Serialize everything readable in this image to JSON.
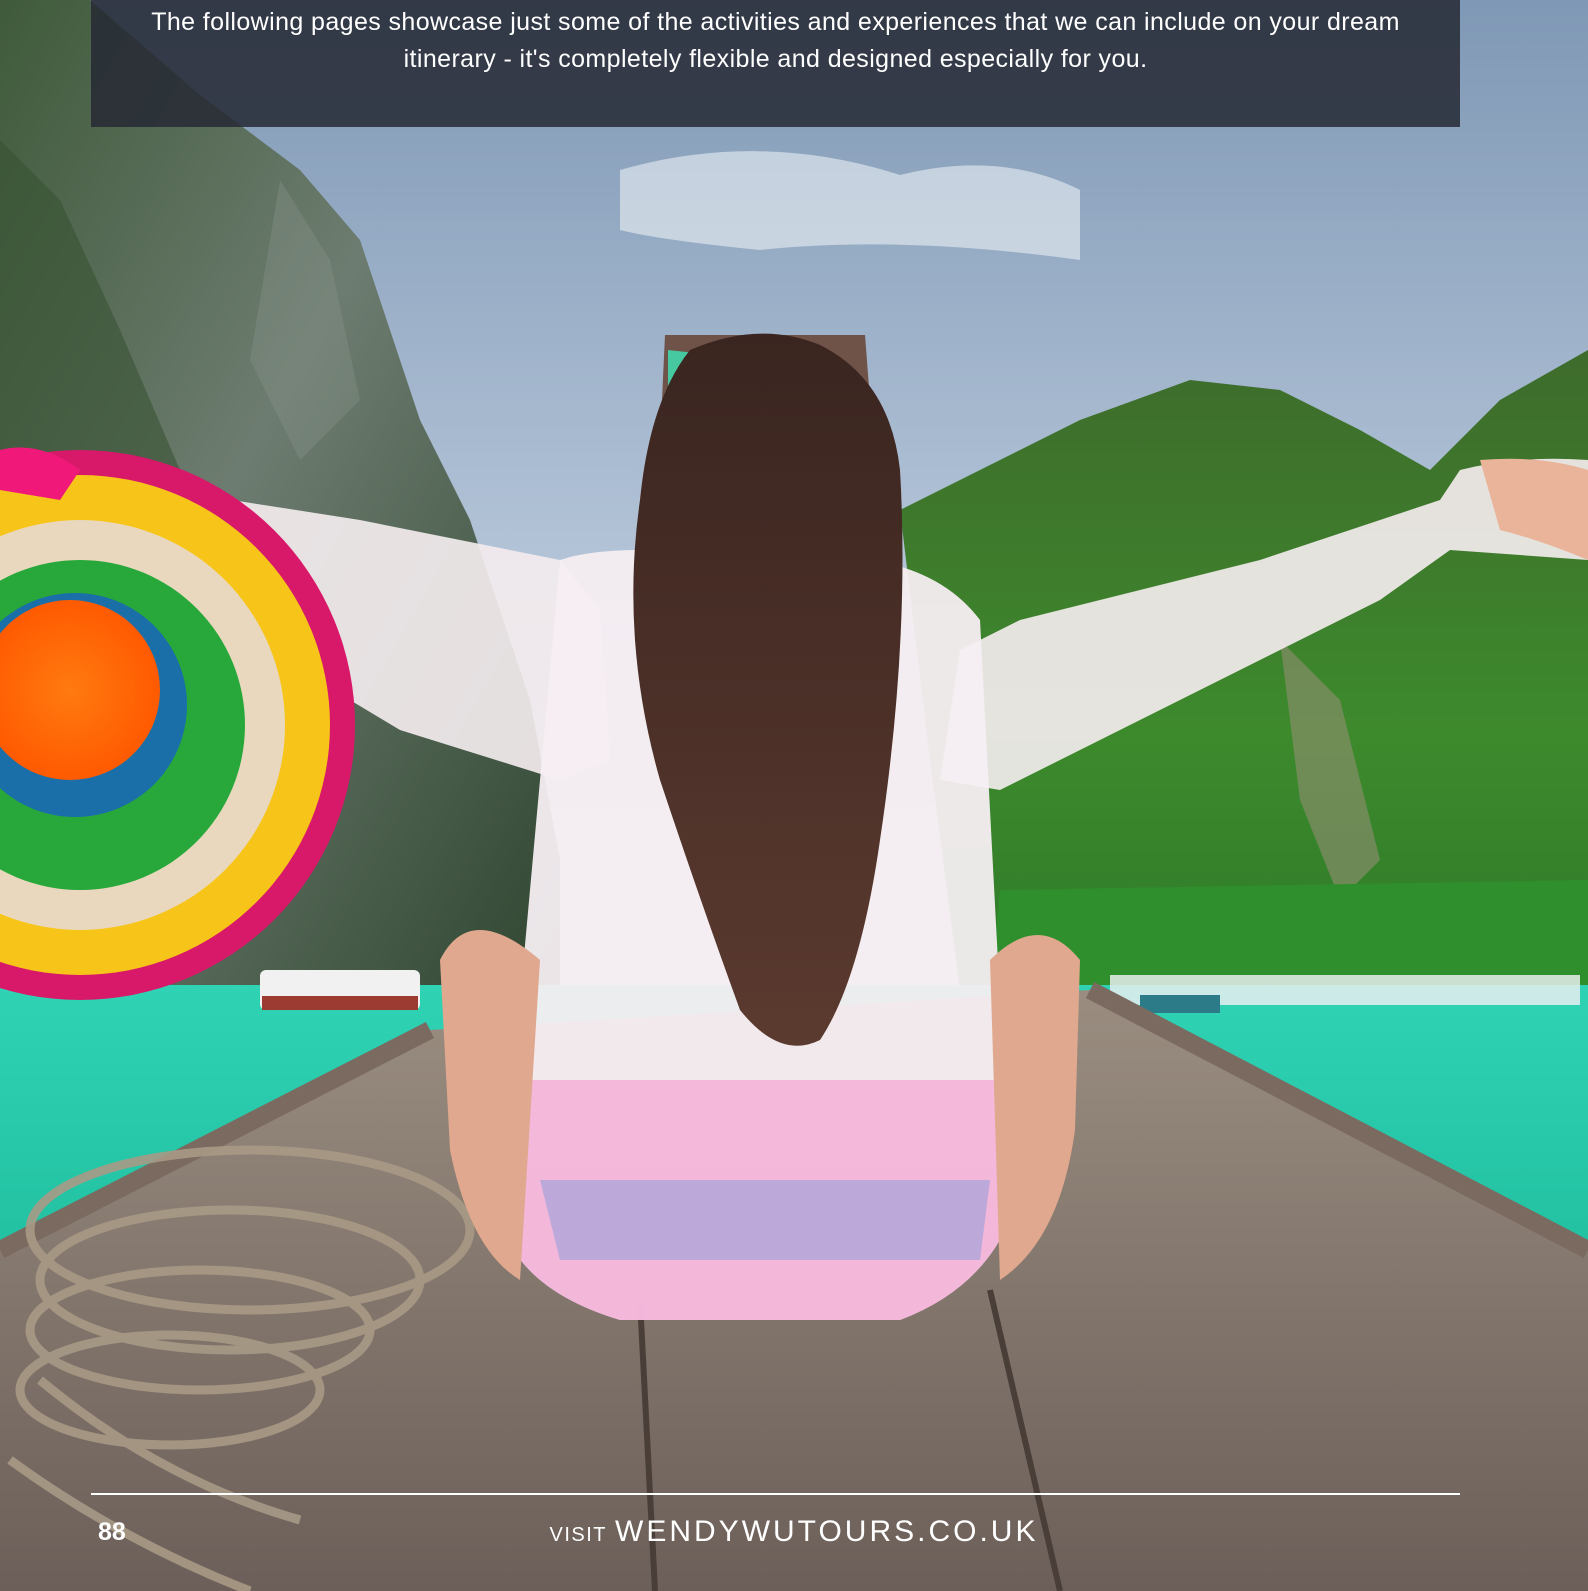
{
  "banner": {
    "text": "The following pages showcase just some of the activities and experiences that we can include on your dream itinerary - it's completely flexible and designed especially for you."
  },
  "footer": {
    "page_number": "88",
    "visit_label": "VISIT",
    "website": "WENDYWUTOURS.CO.UK"
  },
  "colors": {
    "banner_bg": "#262a34",
    "text": "#ffffff",
    "sea": "#1fc4a6",
    "deck": "#8f7c73"
  }
}
